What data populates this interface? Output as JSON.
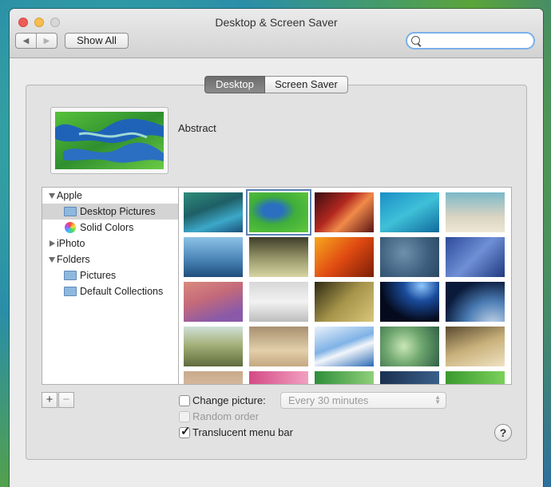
{
  "window": {
    "title": "Desktop & Screen Saver"
  },
  "toolbar": {
    "back_icon": "◀",
    "forward_icon": "▶",
    "show_all_label": "Show All",
    "search_value": "",
    "search_placeholder": ""
  },
  "tabs": [
    {
      "label": "Desktop",
      "selected": true
    },
    {
      "label": "Screen Saver",
      "selected": false
    }
  ],
  "current_wallpaper": {
    "name": "Abstract"
  },
  "sources": [
    {
      "label": "Apple",
      "type": "group",
      "expanded": true,
      "icon": "disclosure-down-icon"
    },
    {
      "label": "Desktop Pictures",
      "type": "folder",
      "selected": true,
      "icon": "folder-icon"
    },
    {
      "label": "Solid Colors",
      "type": "colors",
      "icon": "color-wheel-icon"
    },
    {
      "label": "iPhoto",
      "type": "group",
      "expanded": false,
      "icon": "disclosure-right-icon"
    },
    {
      "label": "Folders",
      "type": "group",
      "expanded": true,
      "icon": "disclosure-down-icon"
    },
    {
      "label": "Pictures",
      "type": "folder",
      "icon": "folder-icon"
    },
    {
      "label": "Default Collections",
      "type": "folder",
      "icon": "folder-icon"
    }
  ],
  "bottom": {
    "add_label": "+",
    "remove_label": "−",
    "change_picture_label": "Change picture:",
    "change_picture_checked": false,
    "interval_value": "Every 30 minutes",
    "random_order_label": "Random order",
    "random_order_checked": false,
    "translucent_label": "Translucent menu bar",
    "translucent_checked": true,
    "help_label": "?"
  },
  "colors": {
    "accent": "#5a7fb5",
    "tab_selected": "#7b7b7b",
    "search_focus": "#7ab0ea"
  }
}
